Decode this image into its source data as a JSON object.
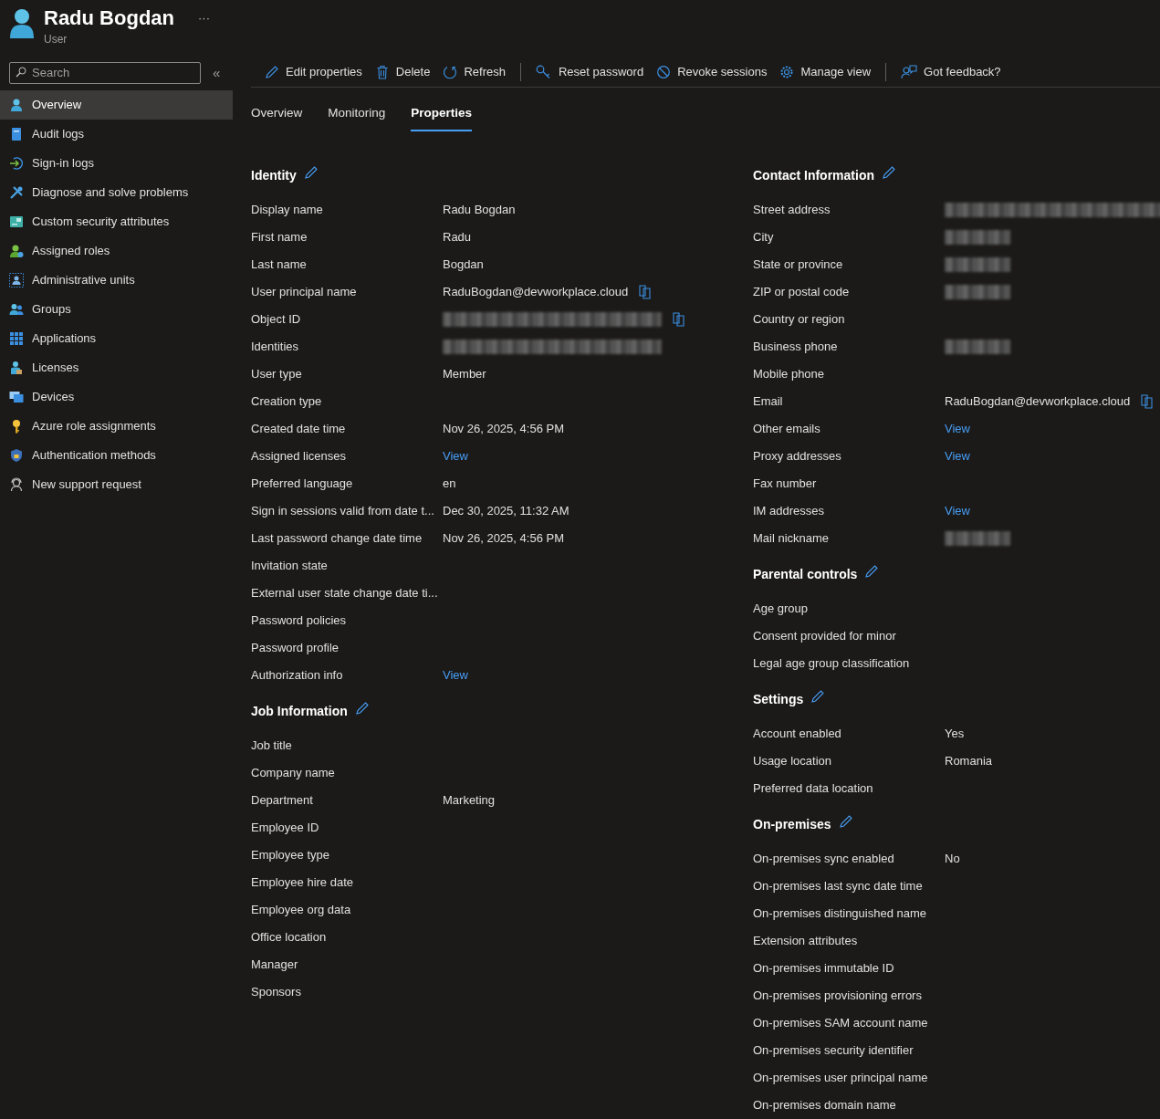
{
  "header": {
    "title": "Radu Bogdan",
    "subtitle": "User",
    "more": "···"
  },
  "search": {
    "placeholder": "Search"
  },
  "collapse": "«",
  "nav": [
    {
      "label": "Overview",
      "selected": true
    },
    {
      "label": "Audit logs",
      "selected": false
    },
    {
      "label": "Sign-in logs",
      "selected": false
    },
    {
      "label": "Diagnose and solve problems",
      "selected": false
    },
    {
      "label": "Custom security attributes",
      "selected": false
    },
    {
      "label": "Assigned roles",
      "selected": false
    },
    {
      "label": "Administrative units",
      "selected": false
    },
    {
      "label": "Groups",
      "selected": false
    },
    {
      "label": "Applications",
      "selected": false
    },
    {
      "label": "Licenses",
      "selected": false
    },
    {
      "label": "Devices",
      "selected": false
    },
    {
      "label": "Azure role assignments",
      "selected": false
    },
    {
      "label": "Authentication methods",
      "selected": false
    },
    {
      "label": "New support request",
      "selected": false
    }
  ],
  "toolbar": [
    [
      "Edit properties",
      "Delete",
      "Refresh"
    ],
    [
      "Reset password",
      "Revoke sessions",
      "Manage view"
    ],
    [
      "Got feedback?"
    ]
  ],
  "tabs": [
    {
      "label": "Overview",
      "selected": false
    },
    {
      "label": "Monitoring",
      "selected": false
    },
    {
      "label": "Properties",
      "selected": true
    }
  ],
  "columns": [
    [
      {
        "title": "Identity",
        "rows": [
          {
            "label": "Display name",
            "kind": "text",
            "value": "Radu Bogdan"
          },
          {
            "label": "First name",
            "kind": "text",
            "value": "Radu"
          },
          {
            "label": "Last name",
            "kind": "text",
            "value": "Bogdan"
          },
          {
            "label": "User principal name",
            "kind": "text",
            "value": "RaduBogdan@devworkplace.cloud",
            "copyable": true
          },
          {
            "label": "Object ID",
            "kind": "blurred_wide",
            "copyable": true
          },
          {
            "label": "Identities",
            "kind": "blurred_wide"
          },
          {
            "label": "User type",
            "kind": "text",
            "value": "Member"
          },
          {
            "label": "Creation type",
            "kind": "empty"
          },
          {
            "label": "Created date time",
            "kind": "text",
            "value": "Nov 26, 2025, 4:56 PM"
          },
          {
            "label": "Assigned licenses",
            "kind": "link",
            "value": "View"
          },
          {
            "label": "Preferred language",
            "kind": "text",
            "value": "en"
          },
          {
            "label": "Sign in sessions valid from date t...",
            "kind": "text",
            "value": "Dec 30, 2025, 11:32 AM"
          },
          {
            "label": "Last password change date time",
            "kind": "text",
            "value": "Nov 26, 2025, 4:56 PM"
          },
          {
            "label": "Invitation state",
            "kind": "empty"
          },
          {
            "label": "External user state change date ti...",
            "kind": "empty"
          },
          {
            "label": "Password policies",
            "kind": "empty"
          },
          {
            "label": "Password profile",
            "kind": "empty"
          },
          {
            "label": "Authorization info",
            "kind": "link",
            "value": "View"
          }
        ]
      },
      {
        "title": "Job Information",
        "rows": [
          {
            "label": "Job title",
            "kind": "empty"
          },
          {
            "label": "Company name",
            "kind": "empty"
          },
          {
            "label": "Department",
            "kind": "text",
            "value": "Marketing"
          },
          {
            "label": "Employee ID",
            "kind": "empty"
          },
          {
            "label": "Employee type",
            "kind": "empty"
          },
          {
            "label": "Employee hire date",
            "kind": "empty"
          },
          {
            "label": "Employee org data",
            "kind": "empty"
          },
          {
            "label": "Office location",
            "kind": "empty"
          },
          {
            "label": "Manager",
            "kind": "empty"
          },
          {
            "label": "Sponsors",
            "kind": "empty"
          }
        ]
      }
    ],
    [
      {
        "title": "Contact Information",
        "rows": [
          {
            "label": "Street address",
            "kind": "blurred_wide"
          },
          {
            "label": "City",
            "kind": "blurred"
          },
          {
            "label": "State or province",
            "kind": "blurred"
          },
          {
            "label": "ZIP or postal code",
            "kind": "blurred"
          },
          {
            "label": "Country or region",
            "kind": "empty"
          },
          {
            "label": "Business phone",
            "kind": "blurred"
          },
          {
            "label": "Mobile phone",
            "kind": "empty"
          },
          {
            "label": "Email",
            "kind": "text",
            "value": "RaduBogdan@devworkplace.cloud",
            "copyable": true
          },
          {
            "label": "Other emails",
            "kind": "link",
            "value": "View"
          },
          {
            "label": "Proxy addresses",
            "kind": "link",
            "value": "View"
          },
          {
            "label": "Fax number",
            "kind": "empty"
          },
          {
            "label": "IM addresses",
            "kind": "link",
            "value": "View"
          },
          {
            "label": "Mail nickname",
            "kind": "blurred"
          }
        ]
      },
      {
        "title": "Parental controls",
        "rows": [
          {
            "label": "Age group",
            "kind": "empty"
          },
          {
            "label": "Consent provided for minor",
            "kind": "empty"
          },
          {
            "label": "Legal age group classification",
            "kind": "empty"
          }
        ]
      },
      {
        "title": "Settings",
        "rows": [
          {
            "label": "Account enabled",
            "kind": "text",
            "value": "Yes"
          },
          {
            "label": "Usage location",
            "kind": "text",
            "value": "Romania"
          },
          {
            "label": "Preferred data location",
            "kind": "empty"
          }
        ]
      },
      {
        "title": "On-premises",
        "rows": [
          {
            "label": "On-premises sync enabled",
            "kind": "text",
            "value": "No"
          },
          {
            "label": "On-premises last sync date time",
            "kind": "empty"
          },
          {
            "label": "On-premises distinguished name",
            "kind": "empty"
          },
          {
            "label": "Extension attributes",
            "kind": "empty"
          },
          {
            "label": "On-premises immutable ID",
            "kind": "empty"
          },
          {
            "label": "On-premises provisioning errors",
            "kind": "empty"
          },
          {
            "label": "On-premises SAM account name",
            "kind": "empty"
          },
          {
            "label": "On-premises security identifier",
            "kind": "empty"
          },
          {
            "label": "On-premises user principal name",
            "kind": "empty"
          },
          {
            "label": "On-premises domain name",
            "kind": "empty"
          }
        ]
      }
    ]
  ]
}
